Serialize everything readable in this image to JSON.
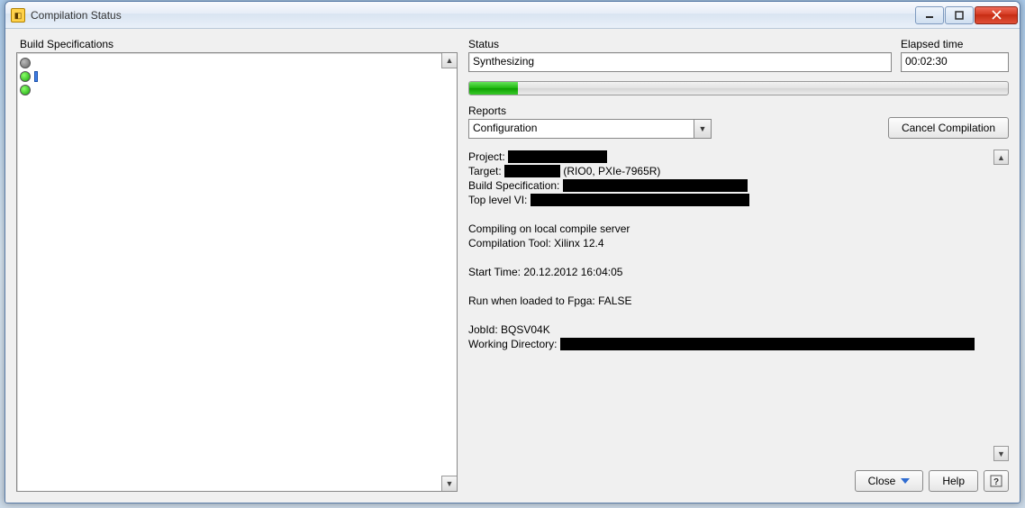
{
  "window": {
    "title": "Compilation Status"
  },
  "left": {
    "build_label": "Build Specifications"
  },
  "right": {
    "status_label": "Status",
    "status_value": "Synthesizing",
    "elapsed_label": "Elapsed time",
    "elapsed_value": "00:02:30",
    "progress_percent": 9,
    "reports_label": "Reports",
    "reports_combo": "Configuration",
    "cancel_button": "Cancel Compilation",
    "report": {
      "project_label": "Project:",
      "target_label": "Target:",
      "target_suffix": "(RIO0, PXIe-7965R)",
      "buildspec_label": "Build Specification:",
      "toplevel_label": "Top level VI:",
      "compiling_on": "Compiling on local compile server",
      "compilation_tool": "Compilation Tool: Xilinx 12.4",
      "start_time": "Start Time: 20.12.2012 16:04:05",
      "run_when_loaded": "Run when loaded to Fpga: FALSE",
      "job_id": "JobId: BQSV04K",
      "workdir_label": "Working Directory:"
    },
    "close_button": "Close",
    "help_button": "Help"
  }
}
